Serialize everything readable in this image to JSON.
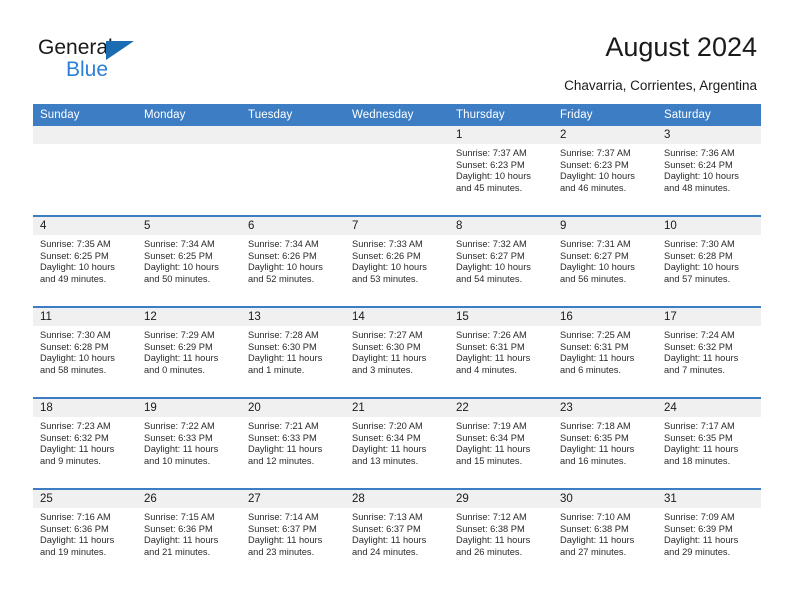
{
  "brand": {
    "name_part1": "General",
    "name_part2": "Blue",
    "triangle_color": "#1b6cb3",
    "blue_text_color": "#2b7fd4"
  },
  "header": {
    "title": "August 2024",
    "subtitle": "Chavarria, Corrientes, Argentina"
  },
  "theme": {
    "header_blue": "#3c7dc4",
    "daynum_band": "#f0f0f0",
    "text": "#1a1a1a"
  },
  "weekday_headers": [
    "Sunday",
    "Monday",
    "Tuesday",
    "Wednesday",
    "Thursday",
    "Friday",
    "Saturday"
  ],
  "weeks": [
    [
      {
        "day": "",
        "empty": true,
        "sunrise": "",
        "sunset": "",
        "daylight1": "",
        "daylight2": ""
      },
      {
        "day": "",
        "empty": true,
        "sunrise": "",
        "sunset": "",
        "daylight1": "",
        "daylight2": ""
      },
      {
        "day": "",
        "empty": true,
        "sunrise": "",
        "sunset": "",
        "daylight1": "",
        "daylight2": ""
      },
      {
        "day": "",
        "empty": true,
        "sunrise": "",
        "sunset": "",
        "daylight1": "",
        "daylight2": ""
      },
      {
        "day": "1",
        "sunrise": "Sunrise: 7:37 AM",
        "sunset": "Sunset: 6:23 PM",
        "daylight1": "Daylight: 10 hours",
        "daylight2": "and 45 minutes."
      },
      {
        "day": "2",
        "sunrise": "Sunrise: 7:37 AM",
        "sunset": "Sunset: 6:23 PM",
        "daylight1": "Daylight: 10 hours",
        "daylight2": "and 46 minutes."
      },
      {
        "day": "3",
        "sunrise": "Sunrise: 7:36 AM",
        "sunset": "Sunset: 6:24 PM",
        "daylight1": "Daylight: 10 hours",
        "daylight2": "and 48 minutes."
      }
    ],
    [
      {
        "day": "4",
        "sunrise": "Sunrise: 7:35 AM",
        "sunset": "Sunset: 6:25 PM",
        "daylight1": "Daylight: 10 hours",
        "daylight2": "and 49 minutes."
      },
      {
        "day": "5",
        "sunrise": "Sunrise: 7:34 AM",
        "sunset": "Sunset: 6:25 PM",
        "daylight1": "Daylight: 10 hours",
        "daylight2": "and 50 minutes."
      },
      {
        "day": "6",
        "sunrise": "Sunrise: 7:34 AM",
        "sunset": "Sunset: 6:26 PM",
        "daylight1": "Daylight: 10 hours",
        "daylight2": "and 52 minutes."
      },
      {
        "day": "7",
        "sunrise": "Sunrise: 7:33 AM",
        "sunset": "Sunset: 6:26 PM",
        "daylight1": "Daylight: 10 hours",
        "daylight2": "and 53 minutes."
      },
      {
        "day": "8",
        "sunrise": "Sunrise: 7:32 AM",
        "sunset": "Sunset: 6:27 PM",
        "daylight1": "Daylight: 10 hours",
        "daylight2": "and 54 minutes."
      },
      {
        "day": "9",
        "sunrise": "Sunrise: 7:31 AM",
        "sunset": "Sunset: 6:27 PM",
        "daylight1": "Daylight: 10 hours",
        "daylight2": "and 56 minutes."
      },
      {
        "day": "10",
        "sunrise": "Sunrise: 7:30 AM",
        "sunset": "Sunset: 6:28 PM",
        "daylight1": "Daylight: 10 hours",
        "daylight2": "and 57 minutes."
      }
    ],
    [
      {
        "day": "11",
        "sunrise": "Sunrise: 7:30 AM",
        "sunset": "Sunset: 6:28 PM",
        "daylight1": "Daylight: 10 hours",
        "daylight2": "and 58 minutes."
      },
      {
        "day": "12",
        "sunrise": "Sunrise: 7:29 AM",
        "sunset": "Sunset: 6:29 PM",
        "daylight1": "Daylight: 11 hours",
        "daylight2": "and 0 minutes."
      },
      {
        "day": "13",
        "sunrise": "Sunrise: 7:28 AM",
        "sunset": "Sunset: 6:30 PM",
        "daylight1": "Daylight: 11 hours",
        "daylight2": "and 1 minute."
      },
      {
        "day": "14",
        "sunrise": "Sunrise: 7:27 AM",
        "sunset": "Sunset: 6:30 PM",
        "daylight1": "Daylight: 11 hours",
        "daylight2": "and 3 minutes."
      },
      {
        "day": "15",
        "sunrise": "Sunrise: 7:26 AM",
        "sunset": "Sunset: 6:31 PM",
        "daylight1": "Daylight: 11 hours",
        "daylight2": "and 4 minutes."
      },
      {
        "day": "16",
        "sunrise": "Sunrise: 7:25 AM",
        "sunset": "Sunset: 6:31 PM",
        "daylight1": "Daylight: 11 hours",
        "daylight2": "and 6 minutes."
      },
      {
        "day": "17",
        "sunrise": "Sunrise: 7:24 AM",
        "sunset": "Sunset: 6:32 PM",
        "daylight1": "Daylight: 11 hours",
        "daylight2": "and 7 minutes."
      }
    ],
    [
      {
        "day": "18",
        "sunrise": "Sunrise: 7:23 AM",
        "sunset": "Sunset: 6:32 PM",
        "daylight1": "Daylight: 11 hours",
        "daylight2": "and 9 minutes."
      },
      {
        "day": "19",
        "sunrise": "Sunrise: 7:22 AM",
        "sunset": "Sunset: 6:33 PM",
        "daylight1": "Daylight: 11 hours",
        "daylight2": "and 10 minutes."
      },
      {
        "day": "20",
        "sunrise": "Sunrise: 7:21 AM",
        "sunset": "Sunset: 6:33 PM",
        "daylight1": "Daylight: 11 hours",
        "daylight2": "and 12 minutes."
      },
      {
        "day": "21",
        "sunrise": "Sunrise: 7:20 AM",
        "sunset": "Sunset: 6:34 PM",
        "daylight1": "Daylight: 11 hours",
        "daylight2": "and 13 minutes."
      },
      {
        "day": "22",
        "sunrise": "Sunrise: 7:19 AM",
        "sunset": "Sunset: 6:34 PM",
        "daylight1": "Daylight: 11 hours",
        "daylight2": "and 15 minutes."
      },
      {
        "day": "23",
        "sunrise": "Sunrise: 7:18 AM",
        "sunset": "Sunset: 6:35 PM",
        "daylight1": "Daylight: 11 hours",
        "daylight2": "and 16 minutes."
      },
      {
        "day": "24",
        "sunrise": "Sunrise: 7:17 AM",
        "sunset": "Sunset: 6:35 PM",
        "daylight1": "Daylight: 11 hours",
        "daylight2": "and 18 minutes."
      }
    ],
    [
      {
        "day": "25",
        "sunrise": "Sunrise: 7:16 AM",
        "sunset": "Sunset: 6:36 PM",
        "daylight1": "Daylight: 11 hours",
        "daylight2": "and 19 minutes."
      },
      {
        "day": "26",
        "sunrise": "Sunrise: 7:15 AM",
        "sunset": "Sunset: 6:36 PM",
        "daylight1": "Daylight: 11 hours",
        "daylight2": "and 21 minutes."
      },
      {
        "day": "27",
        "sunrise": "Sunrise: 7:14 AM",
        "sunset": "Sunset: 6:37 PM",
        "daylight1": "Daylight: 11 hours",
        "daylight2": "and 23 minutes."
      },
      {
        "day": "28",
        "sunrise": "Sunrise: 7:13 AM",
        "sunset": "Sunset: 6:37 PM",
        "daylight1": "Daylight: 11 hours",
        "daylight2": "and 24 minutes."
      },
      {
        "day": "29",
        "sunrise": "Sunrise: 7:12 AM",
        "sunset": "Sunset: 6:38 PM",
        "daylight1": "Daylight: 11 hours",
        "daylight2": "and 26 minutes."
      },
      {
        "day": "30",
        "sunrise": "Sunrise: 7:10 AM",
        "sunset": "Sunset: 6:38 PM",
        "daylight1": "Daylight: 11 hours",
        "daylight2": "and 27 minutes."
      },
      {
        "day": "31",
        "sunrise": "Sunrise: 7:09 AM",
        "sunset": "Sunset: 6:39 PM",
        "daylight1": "Daylight: 11 hours",
        "daylight2": "and 29 minutes."
      }
    ]
  ]
}
